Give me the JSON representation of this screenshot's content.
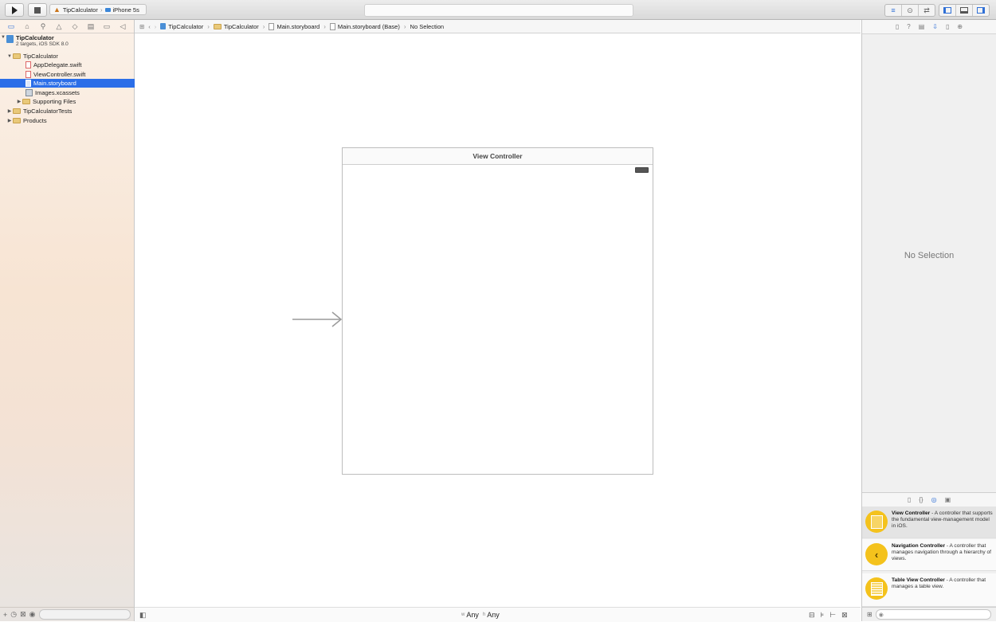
{
  "toolbar": {
    "run_icon": "play-icon",
    "stop_icon": "stop-icon",
    "scheme": {
      "target": "TipCalculator",
      "device": "iPhone 5s"
    },
    "editor_modes": [
      "standard-editor-icon",
      "assistant-editor-icon",
      "version-editor-icon"
    ],
    "view_toggles": [
      "navigator-toggle-icon",
      "debug-area-toggle-icon",
      "utilities-toggle-icon"
    ]
  },
  "navigator": {
    "tabs": [
      "folder-icon",
      "symbol-icon",
      "search-icon",
      "warning-icon",
      "test-icon",
      "debug-icon",
      "breakpoint-icon",
      "report-icon"
    ],
    "project": {
      "name": "TipCalculator",
      "subtitle": "2 targets, iOS SDK 8.0"
    },
    "items": [
      {
        "label": "TipCalculator",
        "type": "group",
        "depth": 1,
        "open": true
      },
      {
        "label": "AppDelegate.swift",
        "type": "swift",
        "depth": 2
      },
      {
        "label": "ViewController.swift",
        "type": "swift",
        "depth": 2
      },
      {
        "label": "Main.storyboard",
        "type": "storyboard",
        "depth": 2,
        "selected": true
      },
      {
        "label": "Images.xcassets",
        "type": "assets",
        "depth": 2
      },
      {
        "label": "Supporting Files",
        "type": "group",
        "depth": 2,
        "open": false
      },
      {
        "label": "TipCalculatorTests",
        "type": "group",
        "depth": 1,
        "open": false
      },
      {
        "label": "Products",
        "type": "group",
        "depth": 1,
        "open": false
      }
    ]
  },
  "jumpbar": {
    "crumbs": [
      "TipCalculator",
      "TipCalculator",
      "Main.storyboard",
      "Main.storyboard (Base)",
      "No Selection"
    ]
  },
  "canvas": {
    "scene_title": "View Controller",
    "size_class": {
      "width": "Any",
      "height": "Any"
    }
  },
  "inspector": {
    "tabs": [
      "file-icon",
      "quick-help-icon",
      "identity-icon",
      "attributes-icon",
      "size-icon",
      "connections-icon"
    ],
    "empty_text": "No Selection",
    "library_tabs": [
      "file-template-icon",
      "code-snippet-icon",
      "object-library-icon",
      "media-library-icon"
    ],
    "library": [
      {
        "title": "View Controller",
        "desc": " - A controller that supports the fundamental view-management model in iOS.",
        "icon": "view-controller-icon"
      },
      {
        "title": "Navigation Controller",
        "desc": " - A controller that manages navigation through a hierarchy of views.",
        "icon": "navigation-controller-icon"
      },
      {
        "title": "Table View Controller",
        "desc": " - A controller that manages a table view.",
        "icon": "table-view-controller-icon"
      }
    ]
  }
}
